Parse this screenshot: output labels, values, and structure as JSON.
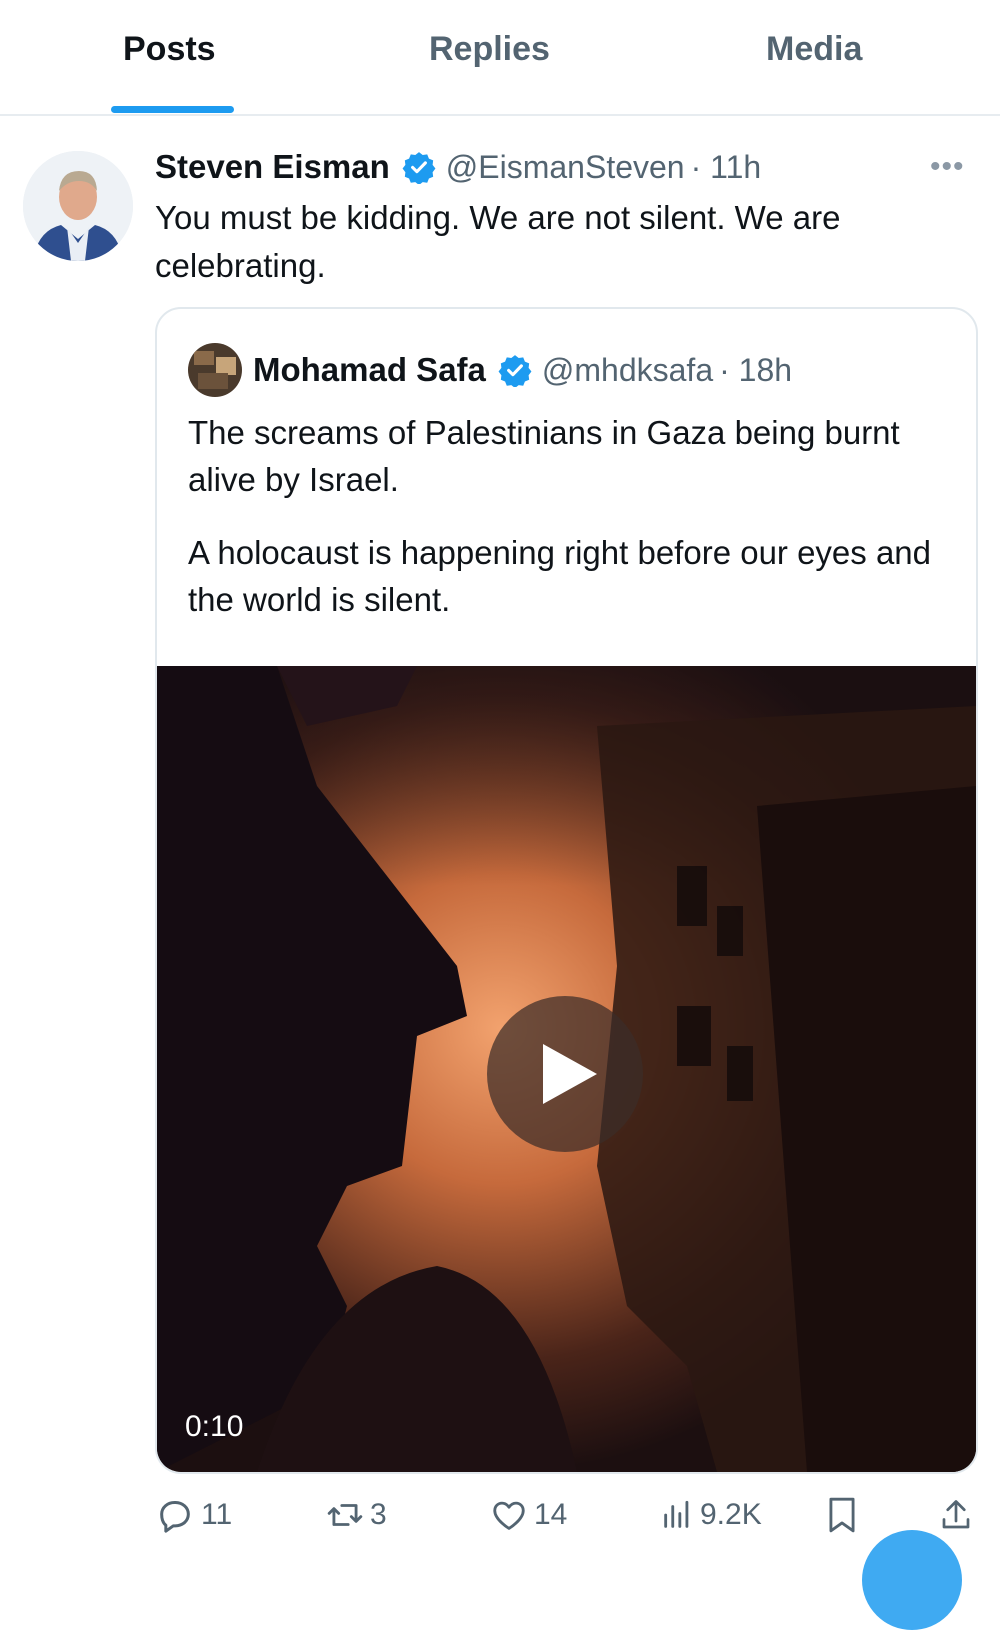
{
  "tabs": [
    {
      "label": "Posts",
      "active": true
    },
    {
      "label": "Replies",
      "active": false
    },
    {
      "label": "Media",
      "active": false
    }
  ],
  "post": {
    "author_name": "Steven Eisman",
    "handle": "@EismanSteven",
    "time": "· 11h",
    "text": "You must be kidding.  We are not silent. We are celebrating.",
    "more_icon": "more-icon"
  },
  "quoted_post": {
    "author_name": "Mohamad Safa",
    "handle": "@mhdksafa",
    "time": "· 18h",
    "paragraphs": [
      "The screams of Palestinians in Gaza being burnt alive by Israel.",
      "A holocaust is happening right before our eyes and the world is silent."
    ],
    "video_duration": "0:10"
  },
  "actions": {
    "replies": "11",
    "reposts": "3",
    "likes": "14",
    "views": "9.2K"
  },
  "colors": {
    "accent": "#1d9bf0",
    "text_primary": "#0f1419",
    "text_secondary": "#536471"
  }
}
